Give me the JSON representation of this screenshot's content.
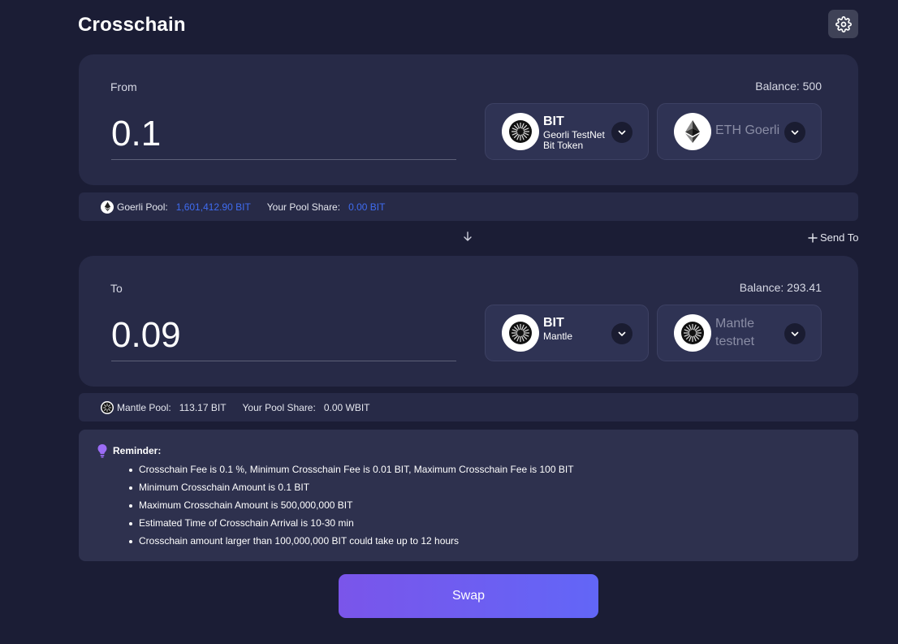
{
  "page": {
    "title": "Crosschain"
  },
  "from": {
    "label": "From",
    "balance": "Balance: 500",
    "amount": "0.1",
    "token": {
      "symbol": "BIT",
      "name": "Georli TestNet Bit Token",
      "icon": "bit-coin-icon"
    },
    "network": {
      "name": "ETH Goerli",
      "icon": "ethereum-icon"
    }
  },
  "goerli_pool": {
    "label": "Goerli Pool:",
    "value": "1,601,412.90 BIT",
    "share_label": "Your Pool Share:",
    "share_value": "0.00 BIT"
  },
  "send_to": {
    "label": "Send To"
  },
  "to": {
    "label": "To",
    "balance": "Balance: 293.41",
    "amount": "0.09",
    "token": {
      "symbol": "BIT",
      "name": "Mantle",
      "icon": "bit-coin-icon"
    },
    "network": {
      "name": "Mantle testnet",
      "icon": "bit-coin-icon"
    }
  },
  "mantle_pool": {
    "label": "Mantle Pool:",
    "value": "113.17 BIT",
    "share_label": "Your Pool Share:",
    "share_value": "0.00 WBIT"
  },
  "reminder": {
    "title": "Reminder:",
    "items": [
      "Crosschain Fee is 0.1 %, Minimum Crosschain Fee is 0.01 BIT, Maximum Crosschain Fee is 100 BIT",
      "Minimum Crosschain Amount is 0.1 BIT",
      "Maximum Crosschain Amount is 500,000,000 BIT",
      "Estimated Time of Crosschain Arrival is 10-30 min",
      "Crosschain amount larger than 100,000,000 BIT could take up to 12 hours"
    ]
  },
  "swap": {
    "label": "Swap"
  },
  "colors": {
    "background": "#1b1d35",
    "panel": "#272a47",
    "link_blue": "#3f6cf0",
    "swap_gradient_start": "#7a55ea",
    "swap_gradient_end": "#6266f7"
  }
}
